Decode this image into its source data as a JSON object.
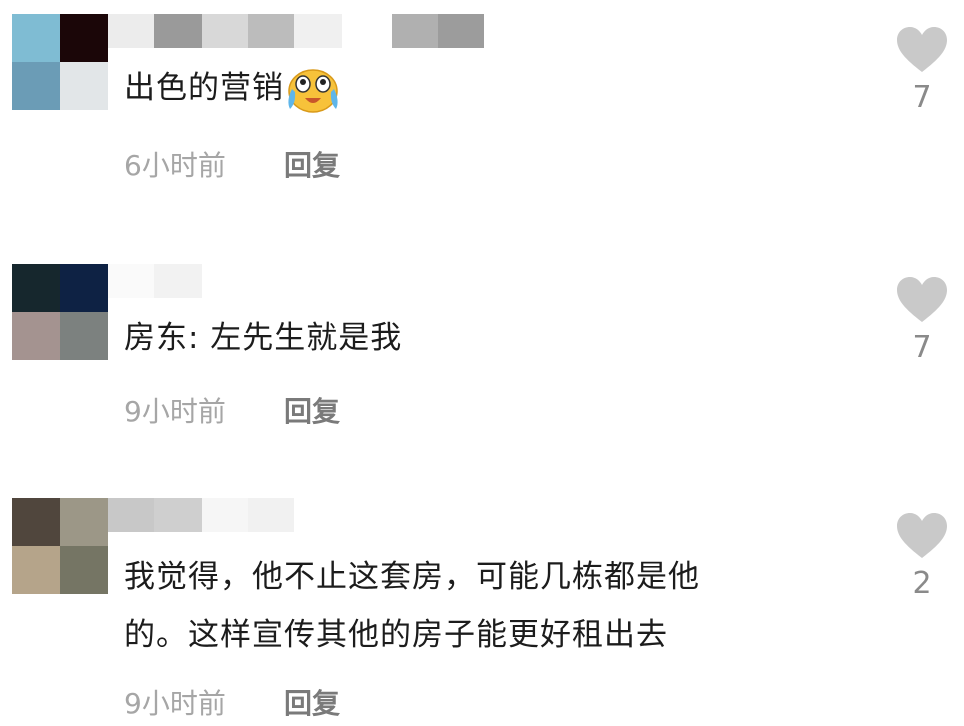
{
  "comments": [
    {
      "text": "出色的营销",
      "emoji_icon": "crying-laughing-emoji-icon",
      "time": "6小时前",
      "reply_label": "回复",
      "likes": "7",
      "avatar_colors": [
        "#7fbcd3",
        "#1b0608",
        "#6b9cb6",
        "#e2e6e8"
      ]
    },
    {
      "text": "房东: 左先生就是我",
      "time": "9小时前",
      "reply_label": "回复",
      "likes": "7",
      "avatar_colors": [
        "#16272d",
        "#0e2244",
        "#a49390",
        "#7c817f"
      ]
    },
    {
      "text_lines": [
        "我觉得，他不止这套房，可能几栋都是他",
        "的。这样宣传其他的房子能更好租出去"
      ],
      "time": "9小时前",
      "reply_label": "回复",
      "likes": "2",
      "avatar_colors": [
        "#50463d",
        "#9c9787",
        "#b5a48a",
        "#757564"
      ]
    }
  ],
  "colors": {
    "heart": "#c9c9c9",
    "time_text": "#a6a6a6",
    "reply_text": "#7a7a7a",
    "count_text": "#8a8a8a"
  }
}
